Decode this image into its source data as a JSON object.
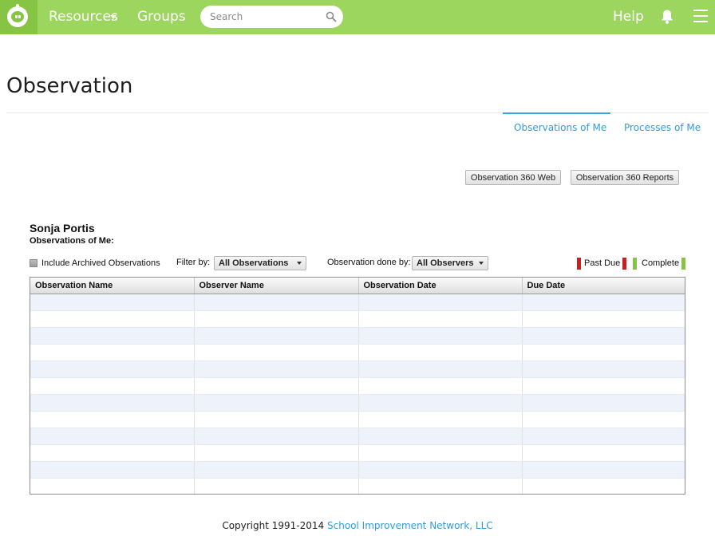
{
  "nav": {
    "resources_label": "Resources",
    "groups_label": "Groups",
    "search_placeholder": "Search",
    "help_label": "Help",
    "bar_color": "#9dd65e",
    "logo_color": "#86c544"
  },
  "page": {
    "title": "Observation"
  },
  "tabs": [
    {
      "label": "Observations of Me",
      "active": true
    },
    {
      "label": "Processes of Me",
      "active": false
    }
  ],
  "actions": {
    "web_label": "Observation 360 Web",
    "reports_label": "Observation 360 Reports"
  },
  "person": {
    "name": "Sonja Portis",
    "subtitle": "Observations of Me:"
  },
  "filters": {
    "archive_label": "Include Archived Observations",
    "archive_checked": false,
    "filter_by_label": "Filter by:",
    "filter_value": "All Observations",
    "done_by_label": "Observation done by:",
    "done_by_value": "All Observers"
  },
  "legend": {
    "past_due_label": "Past Due",
    "past_due_color": "#c8201e",
    "complete_label": "Complete",
    "complete_color": "#86c544"
  },
  "table": {
    "columns": [
      "Observation Name",
      "Observer Name",
      "Observation Date",
      "Due Date"
    ],
    "rows": []
  },
  "footer": {
    "copyright": "Copyright 1991-2014",
    "company_link": "School Improvement Network, LLC"
  },
  "icons": {
    "logo": "apple-logo-icon",
    "search": "search-icon",
    "notifications": "bell-icon",
    "menu": "hamburger-menu-icon"
  }
}
